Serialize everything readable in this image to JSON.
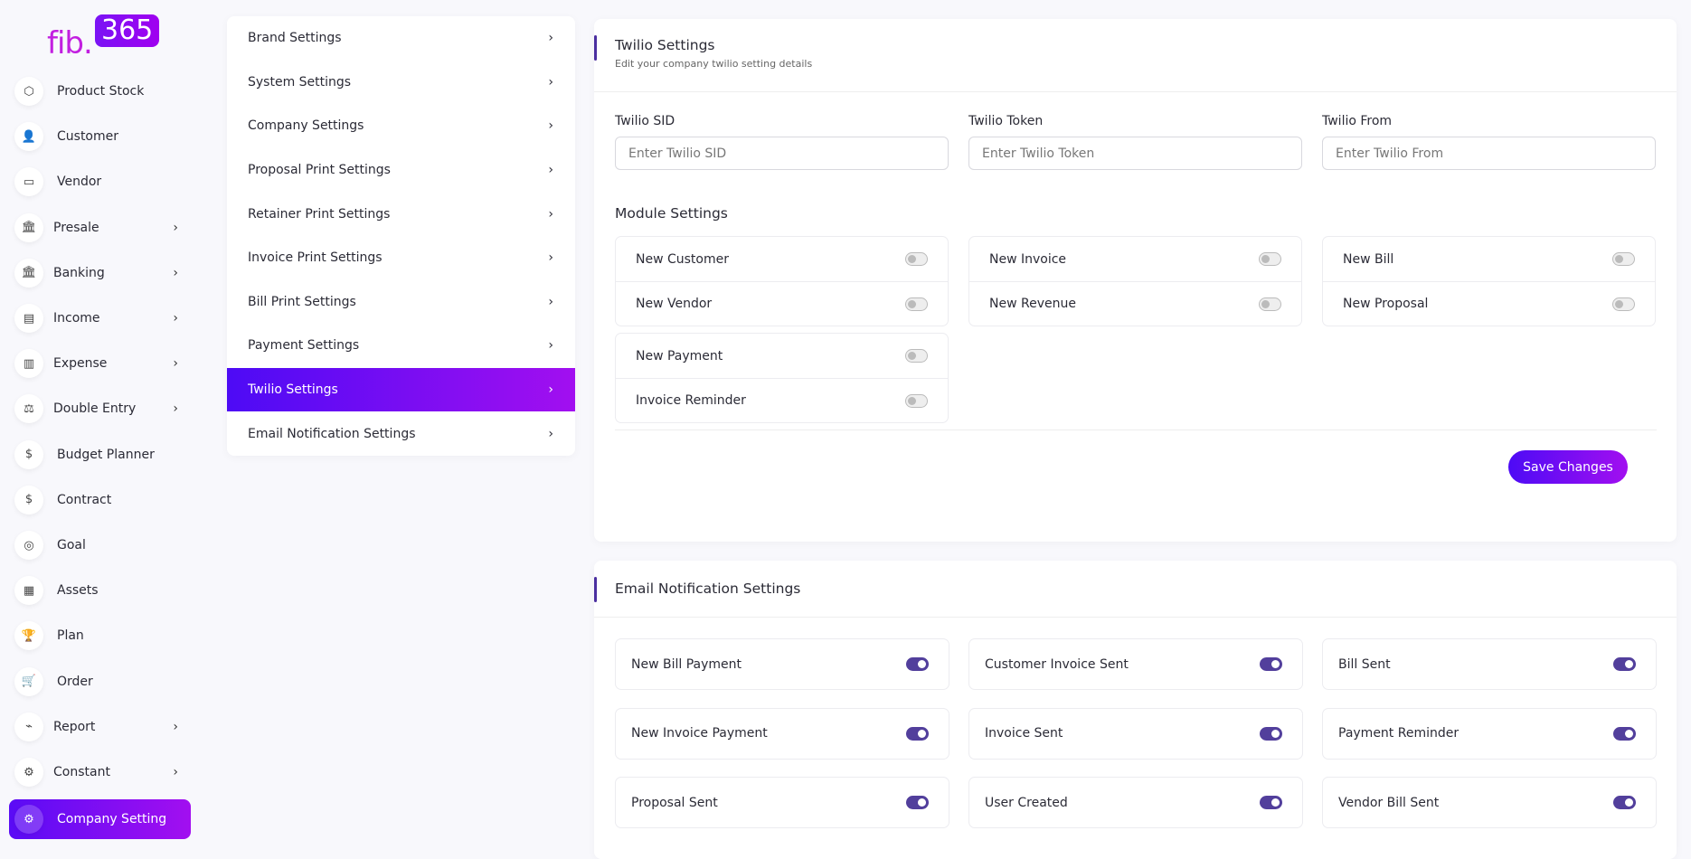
{
  "logo": {
    "text1": "fib.",
    "text2": "365"
  },
  "sidebar": {
    "items": [
      {
        "label": "Product Stock",
        "icon": "box-icon",
        "glyph": "⬡",
        "sub": false
      },
      {
        "label": "Customer",
        "icon": "user-plus-icon",
        "glyph": "👤",
        "sub": false
      },
      {
        "label": "Vendor",
        "icon": "note-icon",
        "glyph": "▭",
        "sub": false
      },
      {
        "label": "Presale",
        "icon": "bank-icon",
        "glyph": "🏛",
        "sub": true
      },
      {
        "label": "Banking",
        "icon": "bank-icon",
        "glyph": "🏛",
        "sub": true
      },
      {
        "label": "Income",
        "icon": "file-icon",
        "glyph": "▤",
        "sub": true
      },
      {
        "label": "Expense",
        "icon": "clipboard-icon",
        "glyph": "▥",
        "sub": true
      },
      {
        "label": "Double Entry",
        "icon": "scale-icon",
        "glyph": "⚖",
        "sub": true
      },
      {
        "label": "Budget Planner",
        "icon": "coins-icon",
        "glyph": "$",
        "sub": false
      },
      {
        "label": "Contract",
        "icon": "coins-icon",
        "glyph": "$",
        "sub": false
      },
      {
        "label": "Goal",
        "icon": "target-icon",
        "glyph": "◎",
        "sub": false
      },
      {
        "label": "Assets",
        "icon": "calculator-icon",
        "glyph": "▦",
        "sub": false
      },
      {
        "label": "Plan",
        "icon": "trophy-icon",
        "glyph": "🏆",
        "sub": false
      },
      {
        "label": "Order",
        "icon": "cart-icon",
        "glyph": "🛒",
        "sub": false
      },
      {
        "label": "Report",
        "icon": "chart-icon",
        "glyph": "⌁",
        "sub": true
      },
      {
        "label": "Constant",
        "icon": "settings-icon",
        "glyph": "⚙",
        "sub": true
      },
      {
        "label": "Company Setting",
        "icon": "gear-icon",
        "glyph": "⚙",
        "sub": false,
        "active": true
      }
    ]
  },
  "menu": {
    "items": [
      "Brand Settings",
      "System Settings",
      "Company Settings",
      "Proposal Print Settings",
      "Retainer Print Settings",
      "Invoice Print Settings",
      "Bill Print Settings",
      "Payment Settings",
      "Twilio Settings",
      "Email Notification Settings"
    ],
    "active": "Twilio Settings"
  },
  "twilio": {
    "title": "Twilio Settings",
    "subtitle": "Edit your company twilio setting details",
    "fields": [
      {
        "label": "Twilio SID",
        "placeholder": "Enter Twilio SID"
      },
      {
        "label": "Twilio Token",
        "placeholder": "Enter Twilio Token"
      },
      {
        "label": "Twilio From",
        "placeholder": "Enter Twilio From"
      }
    ],
    "module_title": "Module Settings",
    "modules": [
      [
        {
          "label": "New Customer",
          "on": false
        },
        {
          "label": "New Vendor",
          "on": false
        }
      ],
      [
        {
          "label": "New Invoice",
          "on": false
        },
        {
          "label": "New Revenue",
          "on": false
        }
      ],
      [
        {
          "label": "New Bill",
          "on": false
        },
        {
          "label": "New Proposal",
          "on": false
        }
      ],
      [
        {
          "label": "New Payment",
          "on": false
        },
        {
          "label": "Invoice Reminder",
          "on": false
        }
      ]
    ],
    "save": "Save Changes"
  },
  "email": {
    "title": "Email Notification Settings",
    "items": [
      {
        "label": "New Bill Payment",
        "on": true
      },
      {
        "label": "Customer Invoice Sent",
        "on": true
      },
      {
        "label": "Bill Sent",
        "on": true
      },
      {
        "label": "New Invoice Payment",
        "on": true
      },
      {
        "label": "Invoice Sent",
        "on": true
      },
      {
        "label": "Payment Reminder",
        "on": true
      },
      {
        "label": "Proposal Sent",
        "on": true
      },
      {
        "label": "User Created",
        "on": true
      },
      {
        "label": "Vendor Bill Sent",
        "on": true
      }
    ]
  },
  "colors": {
    "accent_start": "#4d0bf5",
    "accent_end": "#a20ff0",
    "toggle_on": "#523f9c"
  }
}
